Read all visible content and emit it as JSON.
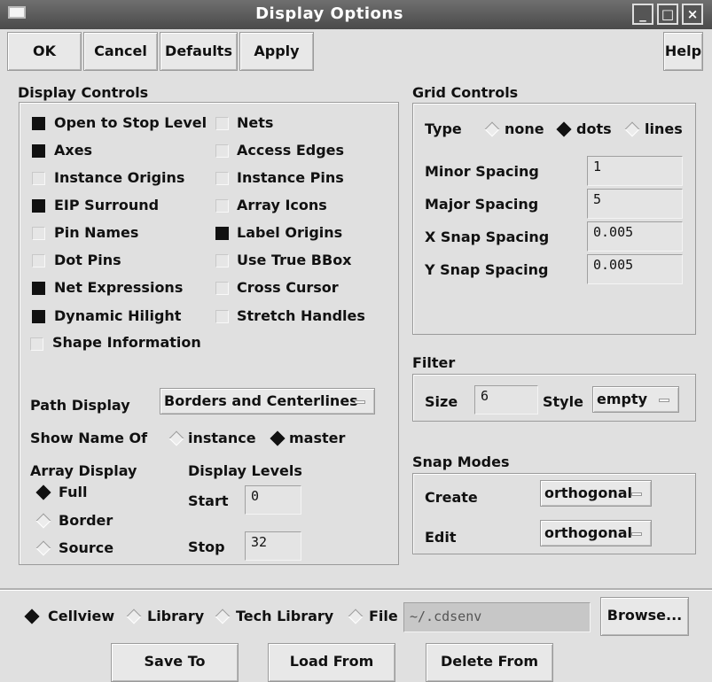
{
  "window": {
    "title": "Display Options",
    "controls": [
      "_",
      "□",
      "×"
    ]
  },
  "toolbar": {
    "ok": "OK",
    "cancel": "Cancel",
    "defaults": "Defaults",
    "apply": "Apply",
    "help": "Help"
  },
  "display_controls": {
    "title": "Display Controls",
    "checkboxes_left": [
      {
        "label": "Open to Stop Level",
        "checked": true
      },
      {
        "label": "Axes",
        "checked": true
      },
      {
        "label": "Instance Origins",
        "checked": false
      },
      {
        "label": "EIP Surround",
        "checked": true
      },
      {
        "label": "Pin Names",
        "checked": false
      },
      {
        "label": "Dot Pins",
        "checked": false
      },
      {
        "label": "Net Expressions",
        "checked": true
      },
      {
        "label": "Dynamic Hilight",
        "checked": true
      },
      {
        "label": "Shape Information",
        "checked": false
      }
    ],
    "checkboxes_right": [
      {
        "label": "Nets",
        "checked": false
      },
      {
        "label": "Access Edges",
        "checked": false
      },
      {
        "label": "Instance Pins",
        "checked": false
      },
      {
        "label": "Array Icons",
        "checked": false
      },
      {
        "label": "Label Origins",
        "checked": true
      },
      {
        "label": "Use True BBox",
        "checked": false
      },
      {
        "label": "Cross Cursor",
        "checked": false
      },
      {
        "label": "Stretch Handles",
        "checked": false
      }
    ],
    "path_display": {
      "label": "Path Display",
      "value": "Borders and Centerlines"
    },
    "show_name_of": {
      "label": "Show Name Of",
      "options": [
        "instance",
        "master"
      ],
      "selected": "master"
    },
    "array_display": {
      "label": "Array Display",
      "options": [
        "Full",
        "Border",
        "Source"
      ],
      "selected": "Full"
    },
    "display_levels": {
      "label": "Display Levels",
      "start_label": "Start",
      "start_value": "0",
      "stop_label": "Stop",
      "stop_value": "32"
    }
  },
  "grid_controls": {
    "title": "Grid Controls",
    "type_label": "Type",
    "type_options": [
      "none",
      "dots",
      "lines"
    ],
    "type_selected": "dots",
    "fields": [
      {
        "label": "Minor Spacing",
        "value": "1"
      },
      {
        "label": "Major Spacing",
        "value": "5"
      },
      {
        "label": "X Snap Spacing",
        "value": "0.005"
      },
      {
        "label": "Y Snap Spacing",
        "value": "0.005"
      }
    ]
  },
  "filter": {
    "title": "Filter",
    "size_label": "Size",
    "size_value": "6",
    "style_label": "Style",
    "style_value": "empty"
  },
  "snap_modes": {
    "title": "Snap Modes",
    "create_label": "Create",
    "create_value": "orthogonal",
    "edit_label": "Edit",
    "edit_value": "orthogonal"
  },
  "bottom": {
    "options": [
      "Cellview",
      "Library",
      "Tech Library",
      "File"
    ],
    "selected": "Cellview",
    "file_value": "~/.cdsenv",
    "browse": "Browse...",
    "save": "Save To",
    "load": "Load From",
    "delete": "Delete From"
  }
}
